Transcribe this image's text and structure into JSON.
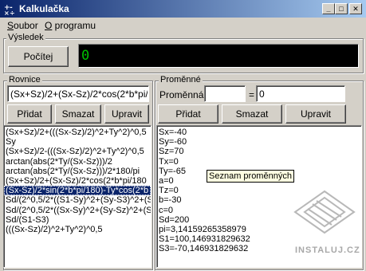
{
  "window": {
    "title": "Kalkulačka",
    "controls": {
      "minimize": "_",
      "maximize": "□",
      "close": "✕"
    }
  },
  "menu": {
    "items": [
      {
        "underline": "S",
        "rest": "oubor"
      },
      {
        "underline": "O",
        "rest": " programu"
      }
    ]
  },
  "result_group": {
    "label": "Výsledek",
    "compute_button": "Počítej",
    "value": "0"
  },
  "equations": {
    "label": "Rovnice",
    "input_value": "(Sx+Sz)/2+(Sx-Sz)/2*cos(2*b*pi/1",
    "add_button": "Přidat",
    "delete_button": "Smazat",
    "edit_button": "Upravit",
    "selected_index": 6,
    "items": [
      "(Sx+Sz)/2+(((Sx-Sz)/2)^2+Ty^2)^0,5",
      "Sy",
      "(Sx+Sz)/2-(((Sx-Sz)/2)^2+Ty^2)^0,5",
      "arctan(abs(2*Ty/(Sx-Sz)))/2",
      "arctan(abs(2*Ty/(Sx-Sz)))/2*180/pi",
      "(Sx+Sz)/2+(Sx-Sz)/2*cos(2*b*pi/180",
      "(Sx-Sz)/2*sin(2*b*pi/180)-Ty*cos(2*b",
      "Sd/(2^0,5/2*((S1-Sy)^2+(Sy-S3)^2+(S",
      "Sd/(2^0,5/2*((Sx-Sy)^2+(Sy-Sz)^2+(S",
      "Sd/(S1-S3)",
      "(((Sx-Sz)/2)^2+Ty^2)^0,5"
    ]
  },
  "variables": {
    "label": "Proměnné",
    "name_label": "Proměnná:",
    "name_value": "",
    "equals": "=",
    "value_value": "0",
    "add_button": "Přidat",
    "delete_button": "Smazat",
    "edit_button": "Upravit",
    "items": [
      "Sx=-40",
      "Sy=-60",
      "Sz=70",
      "Tx=0",
      "Ty=-65",
      "a=0",
      "Tz=0",
      "b=-30",
      "c=0",
      "Sd=200",
      "pi=3,14159265358979",
      "S1=100,146931829632",
      "S3=-70,146931829632"
    ],
    "tooltip": "Seznam proměnných"
  },
  "watermark": {
    "text": "INSTALUJ.CZ"
  },
  "colors": {
    "titlebar_start": "#0a246a",
    "titlebar_end": "#a6caf0",
    "display_bg": "#000000",
    "display_fg": "#00c000",
    "selection_bg": "#0a246a"
  }
}
